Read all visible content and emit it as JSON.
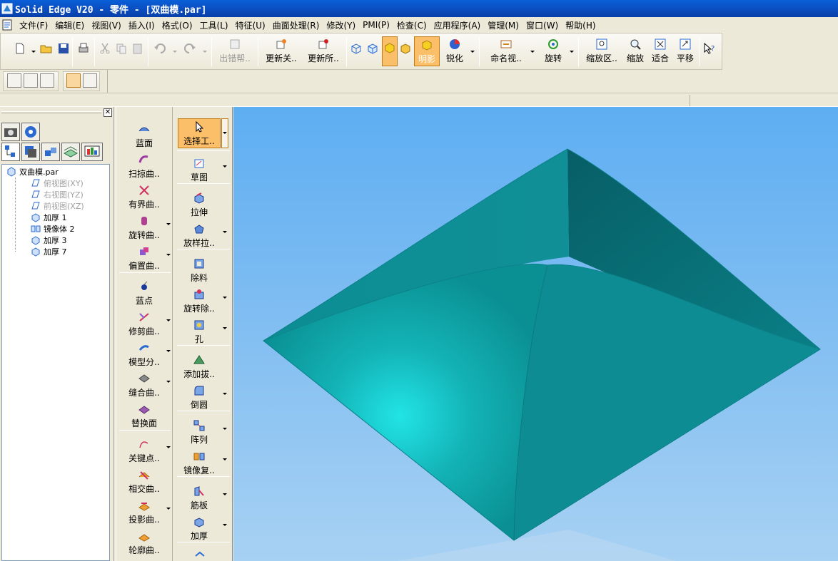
{
  "window": {
    "title": "Solid Edge V20 - 零件 - [双曲模.par]"
  },
  "menu": {
    "items": [
      "文件(F)",
      "编辑(E)",
      "视图(V)",
      "插入(I)",
      "格式(O)",
      "工具(L)",
      "特征(U)",
      "曲面处理(R)",
      "修改(Y)",
      "PMI(P)",
      "检查(C)",
      "应用程序(A)",
      "管理(M)",
      "窗口(W)",
      "帮助(H)"
    ]
  },
  "toolbar": {
    "error_help": "出错帮..",
    "update_related": "更新关..",
    "update_all": "更新所..",
    "shading": "明影",
    "sharpen": "锐化",
    "named_view": "命名视..",
    "rotate": "旋转",
    "zoom_area": "缩放区..",
    "zoom": "缩放",
    "fit": "适合",
    "pan": "平移"
  },
  "surfacing_column": {
    "items": [
      "蓝面",
      "扫掠曲..",
      "有界曲..",
      "旋转曲..",
      "偏置曲..",
      "蓝点",
      "修剪曲..",
      "模型分..",
      "缝合曲..",
      "替换面",
      "关键点..",
      "相交曲..",
      "投影曲..",
      "轮廓曲.."
    ]
  },
  "features_column": {
    "select_tool": "选择工..",
    "items": [
      "草图",
      "拉伸",
      "放样拉..",
      "除料",
      "旋转除..",
      "孔",
      "添加拔..",
      "倒圆",
      "阵列",
      "镜像复..",
      "筋板",
      "加厚"
    ]
  },
  "tree": {
    "root": "双曲模.par",
    "items": [
      {
        "label": "俯视图(XY)",
        "dim": true
      },
      {
        "label": "右视图(YZ)",
        "dim": true
      },
      {
        "label": "前视图(XZ)",
        "dim": true
      },
      {
        "label": "加厚 1",
        "dim": false
      },
      {
        "label": "镜像体 2",
        "dim": false
      },
      {
        "label": "加厚 3",
        "dim": false
      },
      {
        "label": "加厚 7",
        "dim": false
      }
    ]
  },
  "colors": {
    "model_teal": "#0e9c9f",
    "viewport_top": "#5eaef2",
    "viewport_bottom": "#a7d1f3"
  }
}
